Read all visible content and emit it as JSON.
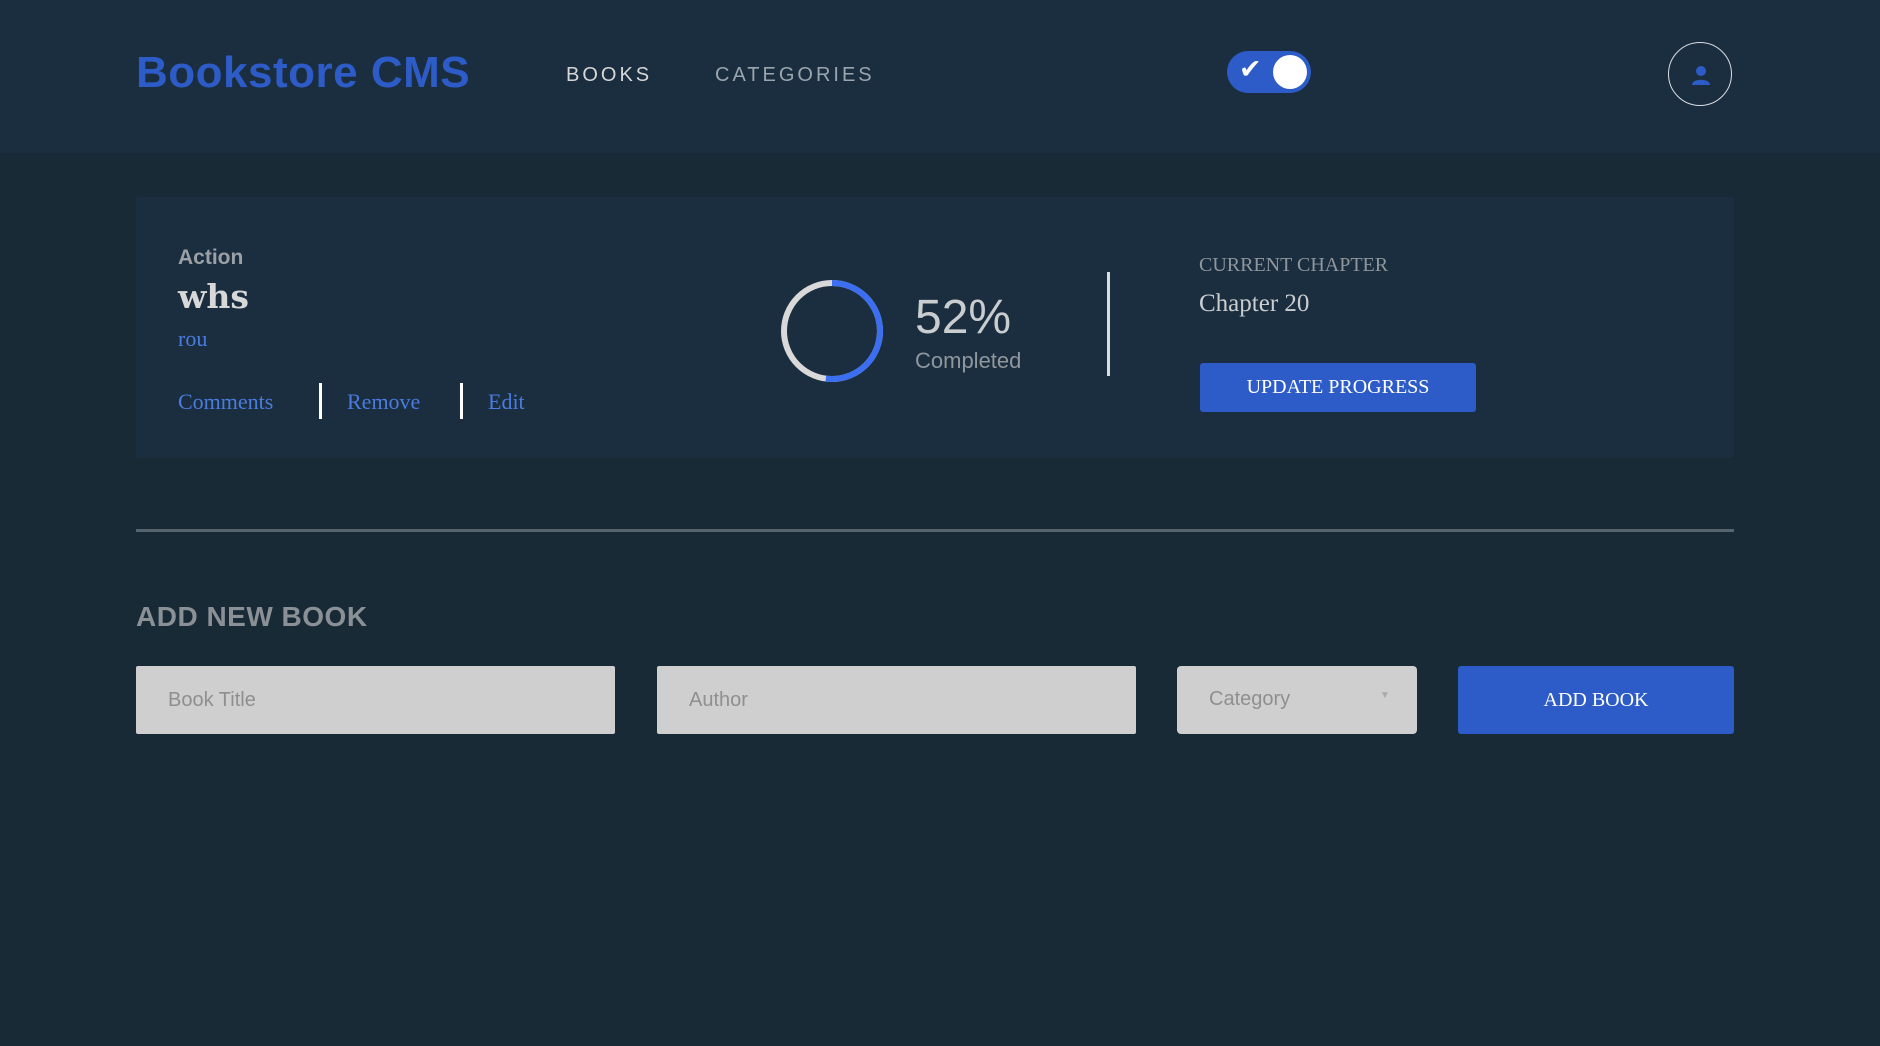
{
  "header": {
    "logo": "Bookstore CMS",
    "nav": {
      "books": "BOOKS",
      "categories": "CATEGORIES"
    },
    "theme_toggle": {
      "on": true,
      "icon": "check-icon"
    },
    "user_icon": "user-icon"
  },
  "book": {
    "genre": "Action",
    "title": "whs",
    "author": "rou",
    "actions": {
      "comments": "Comments",
      "remove": "Remove",
      "edit": "Edit"
    },
    "progress": {
      "percent_value": 52,
      "percent_label": "52%",
      "completed_label": "Completed"
    },
    "current_chapter_label": "CURRENT CHAPTER",
    "current_chapter": "Chapter 20",
    "update_button": "UPDATE PROGRESS"
  },
  "add_book": {
    "heading": "ADD NEW BOOK",
    "title_placeholder": "Book Title",
    "author_placeholder": "Author",
    "category_placeholder": "Category",
    "submit": "ADD BOOK"
  },
  "colors": {
    "accent": "#2d5cc8",
    "background": "#172a35",
    "panel": "#1b2e3f",
    "progress_track": "#d9d9d9",
    "progress_fill": "#3b6ef0"
  }
}
